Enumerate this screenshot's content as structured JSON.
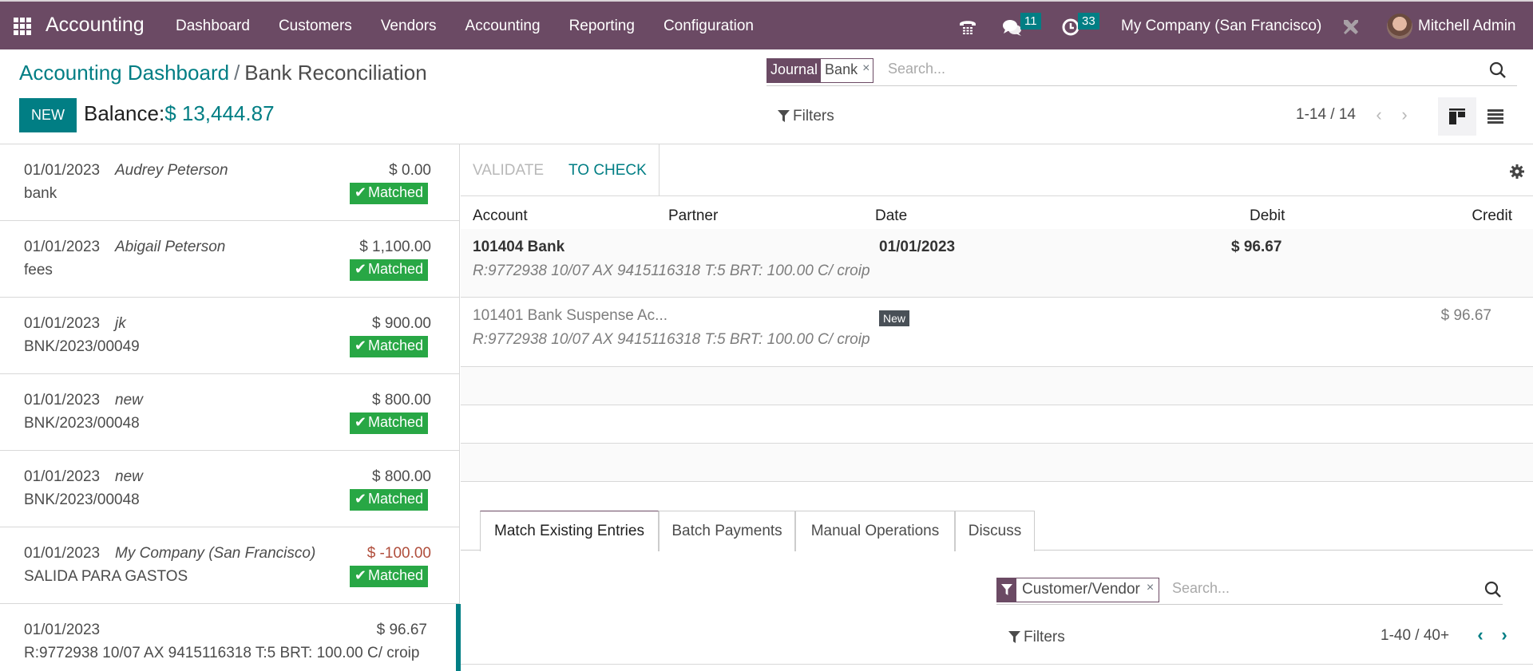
{
  "navbar": {
    "app_name": "Accounting",
    "menu": [
      "Dashboard",
      "Customers",
      "Vendors",
      "Accounting",
      "Reporting",
      "Configuration"
    ],
    "messages_count": "11",
    "activities_count": "33",
    "company": "My Company (San Francisco)",
    "user": "Mitchell Admin",
    "icons": [
      "apps-grid-icon",
      "phone-icon",
      "chat-icon",
      "clock-icon",
      "tools-icon",
      "avatar"
    ]
  },
  "control_panel": {
    "breadcrumb_parent": "Accounting Dashboard",
    "breadcrumb_separator": "/",
    "breadcrumb_current": "Bank Reconciliation",
    "new_label": "NEW",
    "balance_label": "Balance:",
    "balance_amount": "$ 13,444.87",
    "search": {
      "facet_label": "Journal",
      "facet_value": "Bank",
      "facet_remove": "×",
      "placeholder": "Search..."
    },
    "filters_label": "Filters",
    "pager": "1-14 / 14",
    "pager_prev": "‹",
    "pager_next": "›"
  },
  "statements": [
    {
      "date": "01/01/2023",
      "partner": "Audrey Peterson",
      "ref": "bank",
      "amount": "$ 0.00",
      "negative": false,
      "status": "Matched"
    },
    {
      "date": "01/01/2023",
      "partner": "Abigail Peterson",
      "ref": "fees",
      "amount": "$ 1,100.00",
      "negative": false,
      "status": "Matched"
    },
    {
      "date": "01/01/2023",
      "partner": "jk",
      "ref": "BNK/2023/00049",
      "amount": "$ 900.00",
      "negative": false,
      "status": "Matched"
    },
    {
      "date": "01/01/2023",
      "partner": "new",
      "ref": "BNK/2023/00048",
      "amount": "$ 800.00",
      "negative": false,
      "status": "Matched"
    },
    {
      "date": "01/01/2023",
      "partner": "new",
      "ref": "BNK/2023/00048",
      "amount": "$ 800.00",
      "negative": false,
      "status": "Matched"
    },
    {
      "date": "01/01/2023",
      "partner": "My Company (San Francisco)",
      "ref": "SALIDA PARA GASTOS",
      "amount": "$ -100.00",
      "negative": true,
      "status": "Matched"
    },
    {
      "date": "01/01/2023",
      "partner": "",
      "ref": "R:9772938 10/07 AX 9415116318 T:5 BRT: 100.00 C/ croip",
      "amount": "$ 96.67",
      "negative": false,
      "status": ""
    }
  ],
  "detail": {
    "validate_label": "VALIDATE",
    "to_check_label": "TO CHECK",
    "columns": {
      "account": "Account",
      "partner": "Partner",
      "date": "Date",
      "debit": "Debit",
      "credit": "Credit"
    },
    "lines": [
      {
        "account": "101404 Bank",
        "label": "R:9772938 10/07 AX 9415116318 T:5 BRT: 100.00 C/ croip",
        "date": "01/01/2023",
        "debit": "$ 96.67",
        "credit": "",
        "badge": ""
      },
      {
        "account": "101401 Bank Suspense Ac...",
        "label": "R:9772938 10/07 AX 9415116318 T:5 BRT: 100.00 C/ croip",
        "date": "",
        "debit": "",
        "credit": "$ 96.67",
        "badge": "New"
      }
    ],
    "tabs": [
      "Match Existing Entries",
      "Batch Payments",
      "Manual Operations",
      "Discuss"
    ],
    "active_tab": "Match Existing Entries",
    "sub_search": {
      "facet_value": "Customer/Vendor",
      "facet_remove": "×",
      "placeholder": "Search..."
    },
    "sub_filters_label": "Filters",
    "sub_pager": "1-40 / 40+",
    "sub_pager_prev": "‹",
    "sub_pager_next": "›"
  }
}
